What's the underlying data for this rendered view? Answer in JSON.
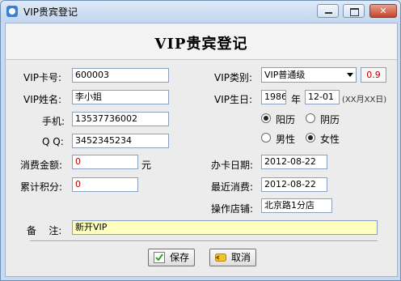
{
  "window": {
    "title": "VIP贵宾登记",
    "buttons": {
      "minimize": "minimize-icon",
      "maximize": "maximize-icon",
      "close": "close-icon"
    }
  },
  "header": {
    "title": "VIP贵宾登记"
  },
  "form": {
    "card_no": {
      "label": "VIP卡号:",
      "value": "600003"
    },
    "name": {
      "label": "VIP姓名:",
      "value": "李小姐"
    },
    "phone": {
      "label": "手机:",
      "value": "13537736002"
    },
    "qq": {
      "label": "Q Q:",
      "value": "3452345234"
    },
    "spend": {
      "label": "消费金额:",
      "value": "0",
      "unit": "元"
    },
    "points": {
      "label": "累计积分:",
      "value": "0"
    },
    "vip_type": {
      "label": "VIP类别:",
      "selected": "VIP普通级",
      "rate": "0.9"
    },
    "birthday": {
      "label": "VIP生日:",
      "year": "1986",
      "year_label": "年",
      "monthday": "12-01",
      "hint": "(XX月XX日)"
    },
    "calendar": {
      "solar": "阳历",
      "lunar": "阴历",
      "selected": "solar"
    },
    "gender": {
      "male": "男性",
      "female": "女性",
      "selected": "female"
    },
    "open_date": {
      "label": "办卡日期:",
      "value": "2012-08-22"
    },
    "last_spend": {
      "label": "最近消费:",
      "value": "2012-08-22"
    },
    "store": {
      "label": "操作店铺:",
      "value": "北京路1分店"
    },
    "remark": {
      "label": "备    注:",
      "value": "新开VIP"
    }
  },
  "actions": {
    "save": "保存",
    "cancel": "取消"
  },
  "colors": {
    "title_bar": "#c3d6ee",
    "close_button": "#c4432b",
    "remark_bg": "#ffffc0",
    "value_red": "#c00000"
  }
}
